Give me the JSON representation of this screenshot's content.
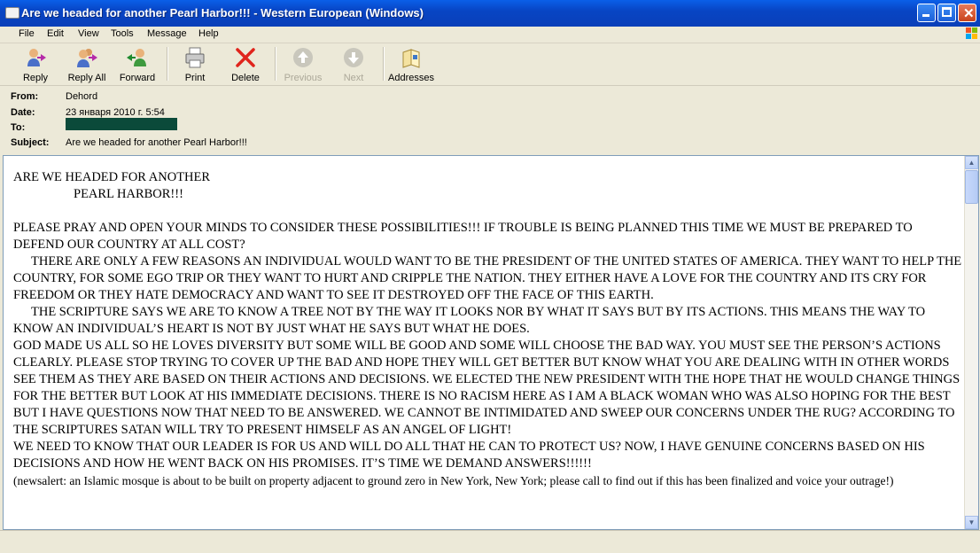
{
  "window": {
    "title": "Are we headed for another Pearl Harbor!!! - Western European (Windows)"
  },
  "menu": [
    "File",
    "Edit",
    "View",
    "Tools",
    "Message",
    "Help"
  ],
  "toolbar": {
    "reply": "Reply",
    "reply_all": "Reply All",
    "forward": "Forward",
    "print": "Print",
    "delete": "Delete",
    "previous": "Previous",
    "next": "Next",
    "addresses": "Addresses"
  },
  "header": {
    "from_label": "From:",
    "from": "Dehord",
    "date_label": "Date:",
    "date": "23 января 2010 г. 5:54",
    "to_label": "To:",
    "subject_label": "Subject:",
    "subject": "Are we headed for another Pearl Harbor!!!"
  },
  "message": {
    "title1": "ARE WE HEADED FOR ANOTHER",
    "title2": "PEARL   HARBOR!!!",
    "p1": "PLEASE PRAY AND OPEN YOUR MINDS TO CONSIDER THESE POSSIBILITIES!!!    IF TROUBLE IS BEING PLANNED THIS  TIME WE MUST BE PREPARED TO DEFEND OUR COUNTRY AT ALL COST?",
    "p2": "THERE ARE ONLY A FEW REASONS AN INDIVIDUAL WOULD WANT TO BE THE PRESIDENT OF THE UNITED STATES OF AMERICA.   THEY WANT TO HELP THE COUNTRY, FOR SOME EGO TRIP OR THEY WANT TO HURT AND CRIPPLE THE NATION.  THEY EITHER HAVE A LOVE FOR THE COUNTRY AND ITS CRY FOR FREEDOM OR THEY HATE  DEMOCRACY AND WANT TO SEE IT DESTROYED OFF THE FACE OF THIS EARTH.",
    "p3": "THE SCRIPTURE SAYS WE ARE TO KNOW A TREE NOT BY THE WAY IT LOOKS NOR BY WHAT IT SAYS BUT BY ITS ACTIONS.  THIS MEANS THE WAY TO KNOW AN INDIVIDUAL’S HEART IS NOT BY JUST WHAT HE SAYS BUT WHAT HE DOES.",
    "p4": "GOD MADE US ALL SO HE LOVES DIVERSITY BUT SOME WILL BE GOOD AND SOME WILL CHOOSE THE BAD WAY.  YOU MUST SEE THE PERSON’S ACTIONS CLEARLY.  PLEASE STOP TRYING TO COVER UP THE BAD AND HOPE THEY WILL GET BETTER BUT KNOW WHAT YOU ARE DEALING WITH IN OTHER WORDS SEE THEM AS THEY ARE BASED ON THEIR ACTIONS AND DECISIONS.   WE ELECTED THE NEW PRESIDENT WITH THE HOPE THAT HE WOULD CHANGE THINGS FOR THE BETTER BUT LOOK AT HIS IMMEDIATE DECISIONS.  THERE IS NO RACISM HERE AS I AM A BLACK  WOMAN WHO WAS ALSO HOPING FOR THE BEST BUT I HAVE QUESTIONS NOW THAT NEED TO BE ANSWERED.   WE CANNOT BE INTIMIDATED AND SWEEP OUR CONCERNS UNDER THE RUG?  ACCORDING TO THE SCRIPTURES SATAN WILL TRY TO PRESENT HIMSELF AS AN ANGEL OF LIGHT!",
    "p5": "WE NEED TO KNOW THAT OUR LEADER IS FOR US AND WILL DO ALL THAT HE CAN TO PROTECT US?  NOW,  I HAVE GENUINE CONCERNS BASED ON HIS DECISIONS AND HOW HE WENT BACK ON HIS PROMISES.      IT’S TIME WE DEMAND ANSWERS!!!!!!",
    "p6": "(newsalert:  an Islamic mosque is about to be built on property adjacent to ground zero in New York, New York;  please call to find out if this has been finalized and voice your outrage!)"
  },
  "colors": {
    "titlebar": "#0A52D8",
    "chrome": "#ECE9D8",
    "redaction": "#0B4A3A",
    "delete_red": "#E0241C"
  }
}
